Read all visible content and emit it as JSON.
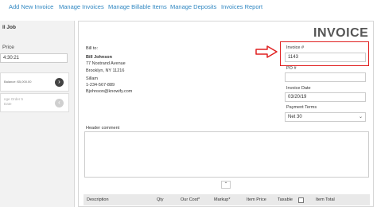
{
  "nav": {
    "links": [
      "Add New Invoice",
      "Manage Invoices",
      "Manage Billable Items",
      "Manage Deposits",
      "Invoices Report"
    ],
    "accent": "#2e86c1"
  },
  "sidebar": {
    "title": "ll Job",
    "price_label": "Price",
    "time_value": "4:30:21",
    "card1_sub": "Balance: $5,000.00",
    "card2_text": "nge Order 5\nDate"
  },
  "invoice": {
    "title": "INVOICE",
    "bill_to": {
      "label": "Bill to:",
      "name": "Bill Johnson",
      "street": "77 Nostrand Avenue",
      "city": "Brooklyn, NY 11216"
    },
    "contact": {
      "name": "Sillam",
      "phone": "1-234-567-889",
      "email": "Bjohnson@knowify.com"
    },
    "fields": {
      "invoice_no_label": "Invoice #",
      "invoice_no_value": "1143",
      "po_label": "PO #",
      "po_value": "",
      "date_label": "Invoice Date",
      "date_value": "03/20/19",
      "terms_label": "Payment Terms",
      "terms_value": "Net 30"
    },
    "header_comment_label": "Header comment",
    "table_headers": [
      "Description",
      "Qty",
      "Our Cost*",
      "Markup*",
      "Item Price",
      "Taxable",
      "Item Total"
    ]
  },
  "colors": {
    "highlight": "#e02020"
  }
}
